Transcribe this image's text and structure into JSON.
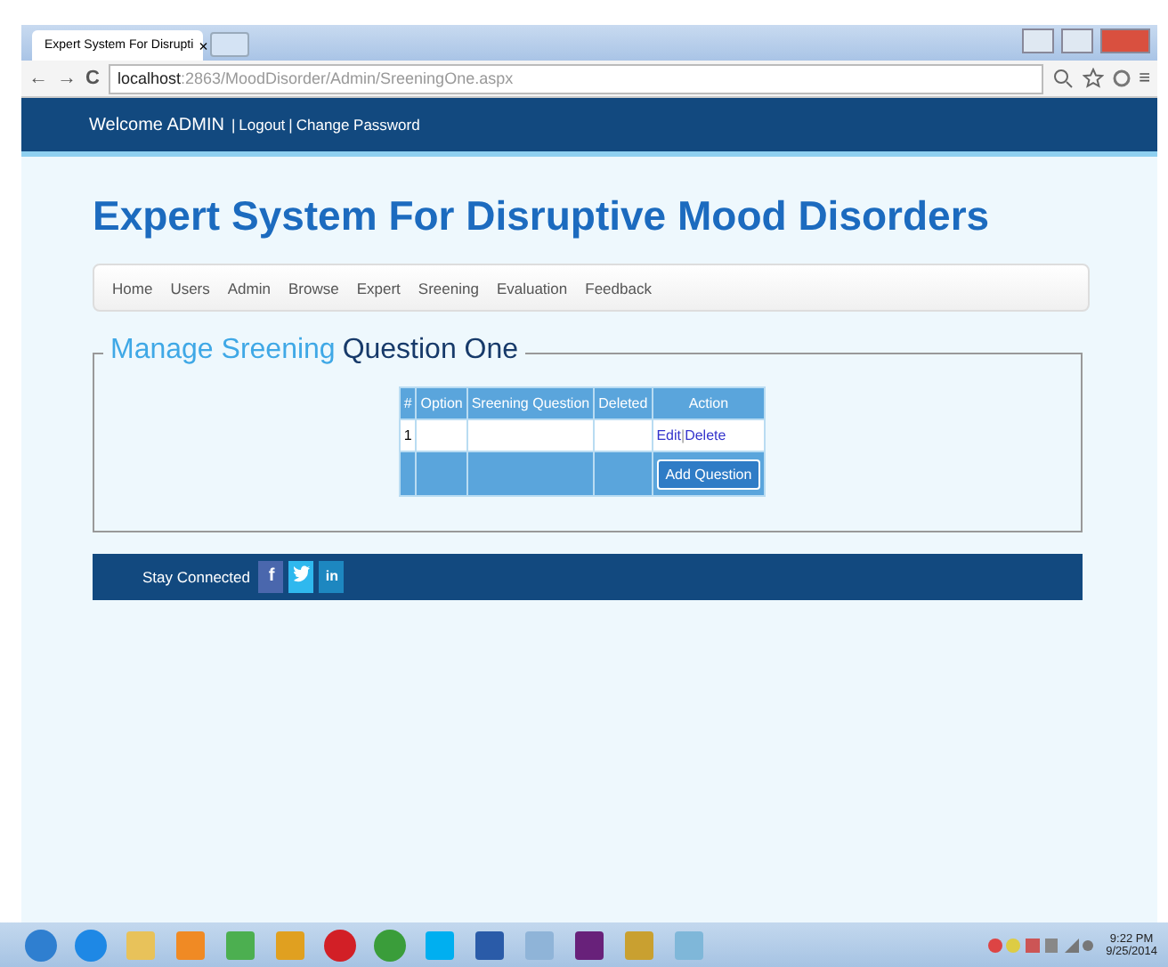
{
  "browser": {
    "tab_title": "Expert System For Disrupti",
    "tab_close": "×",
    "back": "←",
    "forward": "→",
    "reload": "C",
    "url_host": "localhost",
    "url_path": ":2863/MoodDisorder/Admin/SreeningOne.aspx",
    "menu": "≡"
  },
  "header": {
    "welcome": "Welcome ADMIN",
    "separator": "|",
    "links": [
      "Logout",
      "Change Password"
    ]
  },
  "site_title": "Expert System For Disruptive Mood Disorders",
  "nav": [
    "Home",
    "Users",
    "Admin",
    "Browse",
    "Expert",
    "Sreening",
    "Evaluation",
    "Feedback"
  ],
  "section": {
    "title_highlight": "Manage Sreening",
    "title_rest": "Question One"
  },
  "table": {
    "columns": [
      "#",
      "Option",
      "Sreening Question",
      "Deleted",
      "Action"
    ],
    "rows": [
      {
        "cells": [
          "1",
          "",
          "",
          ""
        ],
        "actions": [
          "Edit",
          "Delete"
        ],
        "action_separator": "|"
      }
    ],
    "footer_button": "Add Question"
  },
  "footer": {
    "label": "Stay Connected",
    "social": [
      {
        "kind": "facebook",
        "text": "f"
      },
      {
        "kind": "twitter"
      },
      {
        "kind": "linkedin",
        "text": "in"
      }
    ]
  },
  "taskbar": {
    "apps": [
      {
        "kind": "start"
      },
      {
        "kind": "ie"
      },
      {
        "kind": "folder"
      },
      {
        "kind": "media"
      },
      {
        "kind": "chart"
      },
      {
        "kind": "puzzle"
      },
      {
        "kind": "opera"
      },
      {
        "kind": "chrome"
      },
      {
        "kind": "skype"
      },
      {
        "kind": "word"
      },
      {
        "kind": "paint"
      },
      {
        "kind": "vs"
      },
      {
        "kind": "tool"
      },
      {
        "kind": "notepad"
      }
    ],
    "time": "9:22 PM",
    "date": "9/25/2014"
  }
}
